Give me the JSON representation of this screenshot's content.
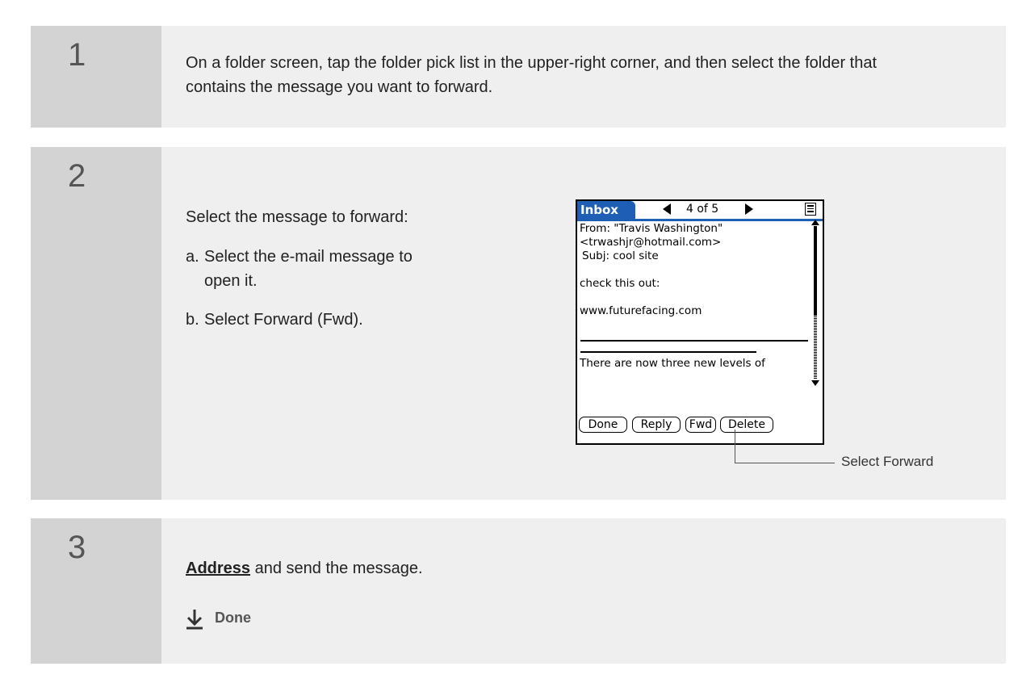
{
  "steps": [
    {
      "number": "1",
      "text": "On a folder screen, tap the folder pick list in the upper-right corner, and then select the folder that contains the message you want to forward."
    },
    {
      "number": "2",
      "intro": "Select the message to forward:",
      "substeps": [
        {
          "letter": "a.",
          "line1": "Select the e-mail message to",
          "line2": "open it."
        },
        {
          "letter": "b.",
          "line1": "Select Forward (Fwd)."
        }
      ],
      "screenshot": {
        "folder": "Inbox",
        "counter": "4 of 5",
        "from": "From:  \"Travis Washington\"",
        "email": "<trwashjr@hotmail.com>",
        "subject": "Subj:  cool site",
        "body1": "check this out:",
        "body2": "www.futurefacing.com",
        "body3": "There are now three new levels of",
        "buttons": {
          "done": "Done",
          "reply": "Reply",
          "fwd": "Fwd",
          "delete": "Delete"
        }
      },
      "callout": "Select Forward"
    },
    {
      "number": "3",
      "link": "Address",
      "text": " and send the message.",
      "done": "Done"
    }
  ]
}
